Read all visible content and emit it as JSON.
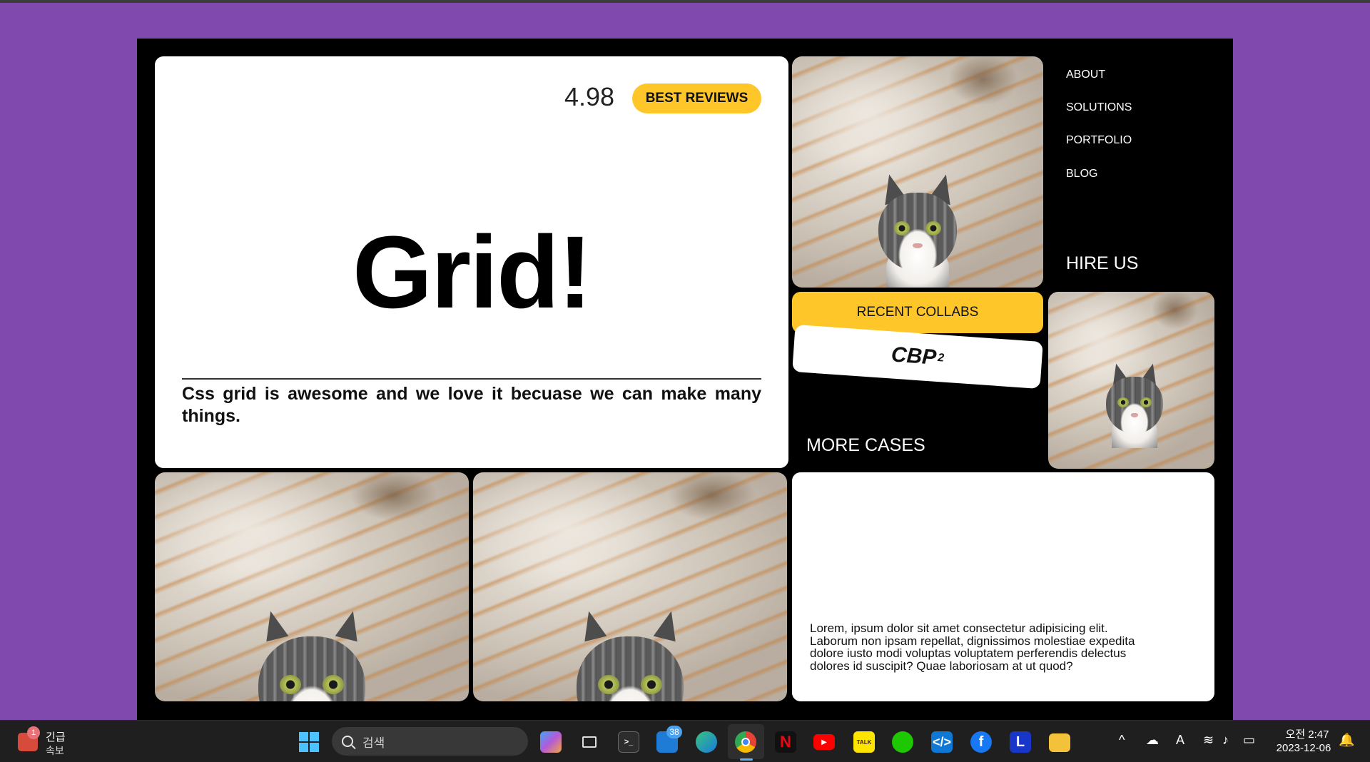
{
  "hero": {
    "rating": "4.98",
    "best_reviews_label": "BEST REVIEWS",
    "title": "Grid!",
    "description": "Css grid is awesome and we love it becuase we can make many things."
  },
  "nav": {
    "items": [
      "ABOUT",
      "SOLUTIONS",
      "PORTFOLIO",
      "BLOG"
    ],
    "hire_label": "HIRE US"
  },
  "collabs": {
    "button_label": "RECENT COLLABS",
    "brand": "CBP",
    "brand_sup": "2",
    "more_cases_label": "MORE CASES"
  },
  "text_card": {
    "body": "Lorem, ipsum dolor sit amet consectetur adipisicing elit. Laborum non ipsam repellat, dignissimos molestiae expedita dolore iusto modi voluptas voluptatem perferendis delectus dolores id suscipit? Quae laboriosam at ut quod?"
  },
  "taskbar": {
    "news_badge": "1",
    "news_line1": "긴급",
    "news_line2": "속보",
    "search_placeholder": "검색",
    "mail_badge": "38",
    "kakao_label": "TALK",
    "lens_label": "L",
    "ime_label": "A",
    "clock_time": "오전 2:47",
    "clock_date": "2023-12-06"
  },
  "colors": {
    "page_background": "#8049ad",
    "accent_yellow": "#ffc62a",
    "canvas_background": "#000000"
  }
}
